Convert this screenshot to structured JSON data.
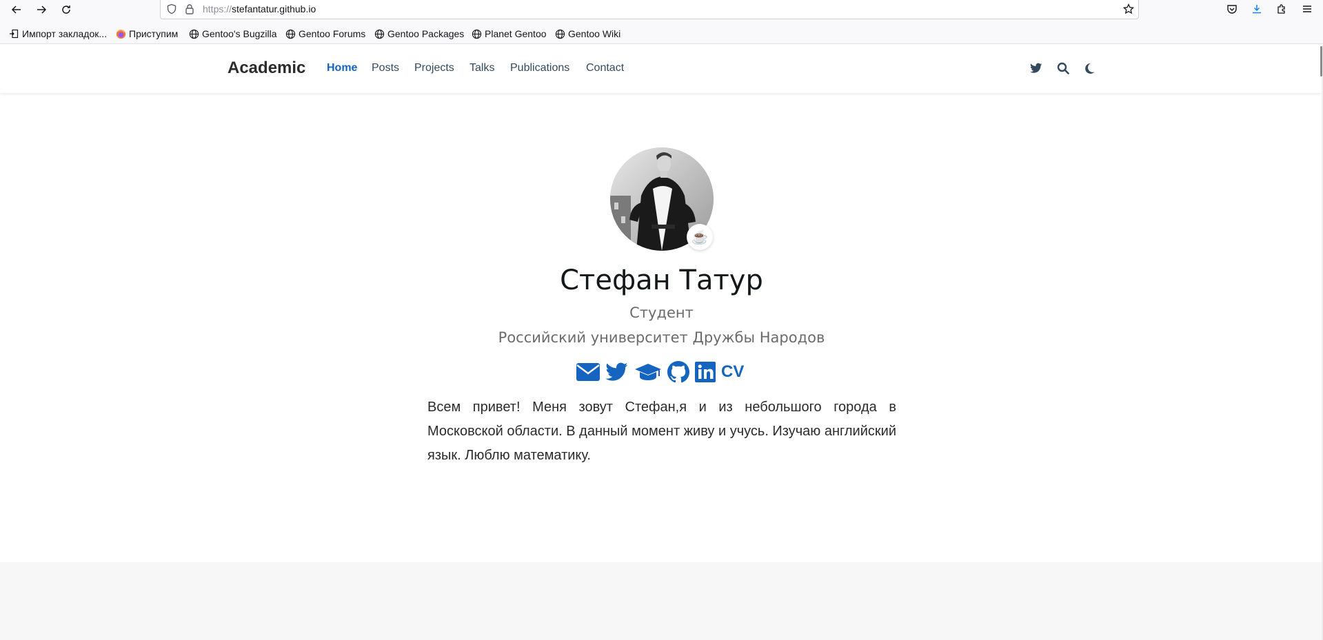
{
  "browser": {
    "url_scheme": "https://",
    "url_host": "stefantatur.github.io",
    "bookmarks": [
      {
        "label": "Импорт закладок...",
        "icon": "import-icon"
      },
      {
        "label": "Приступим",
        "icon": "firefox-icon"
      },
      {
        "label": "Gentoo's Bugzilla",
        "icon": "globe-icon"
      },
      {
        "label": "Gentoo Forums",
        "icon": "globe-icon"
      },
      {
        "label": "Gentoo Packages",
        "icon": "globe-icon"
      },
      {
        "label": "Planet Gentoo",
        "icon": "globe-icon"
      },
      {
        "label": "Gentoo Wiki",
        "icon": "globe-icon"
      }
    ]
  },
  "site": {
    "brand": "Academic",
    "menu": [
      {
        "label": "Home",
        "active": true
      },
      {
        "label": "Posts",
        "active": false
      },
      {
        "label": "Projects",
        "active": false
      },
      {
        "label": "Talks",
        "active": false
      },
      {
        "label": "Publications",
        "active": false
      },
      {
        "label": "Contact",
        "active": false
      }
    ],
    "nav_icons": [
      "twitter-icon",
      "search-icon",
      "moon-icon"
    ]
  },
  "profile": {
    "status_emoji": "☕",
    "name": "Стефан Татур",
    "role": "Студент",
    "organization": "Российский университет Дружбы Народов",
    "socials": [
      "email-icon",
      "twitter-icon",
      "graduation-cap-icon",
      "github-icon",
      "linkedin-icon"
    ],
    "cv_label": "CV",
    "bio": "Всем привет! Меня зовут Стефан,я и из небольшого города в Московской области. В данный момент живу и учусь. Изучаю английский язык. Люблю математику."
  },
  "colors": {
    "accent": "#1565c0",
    "nav_text": "#34495e"
  }
}
